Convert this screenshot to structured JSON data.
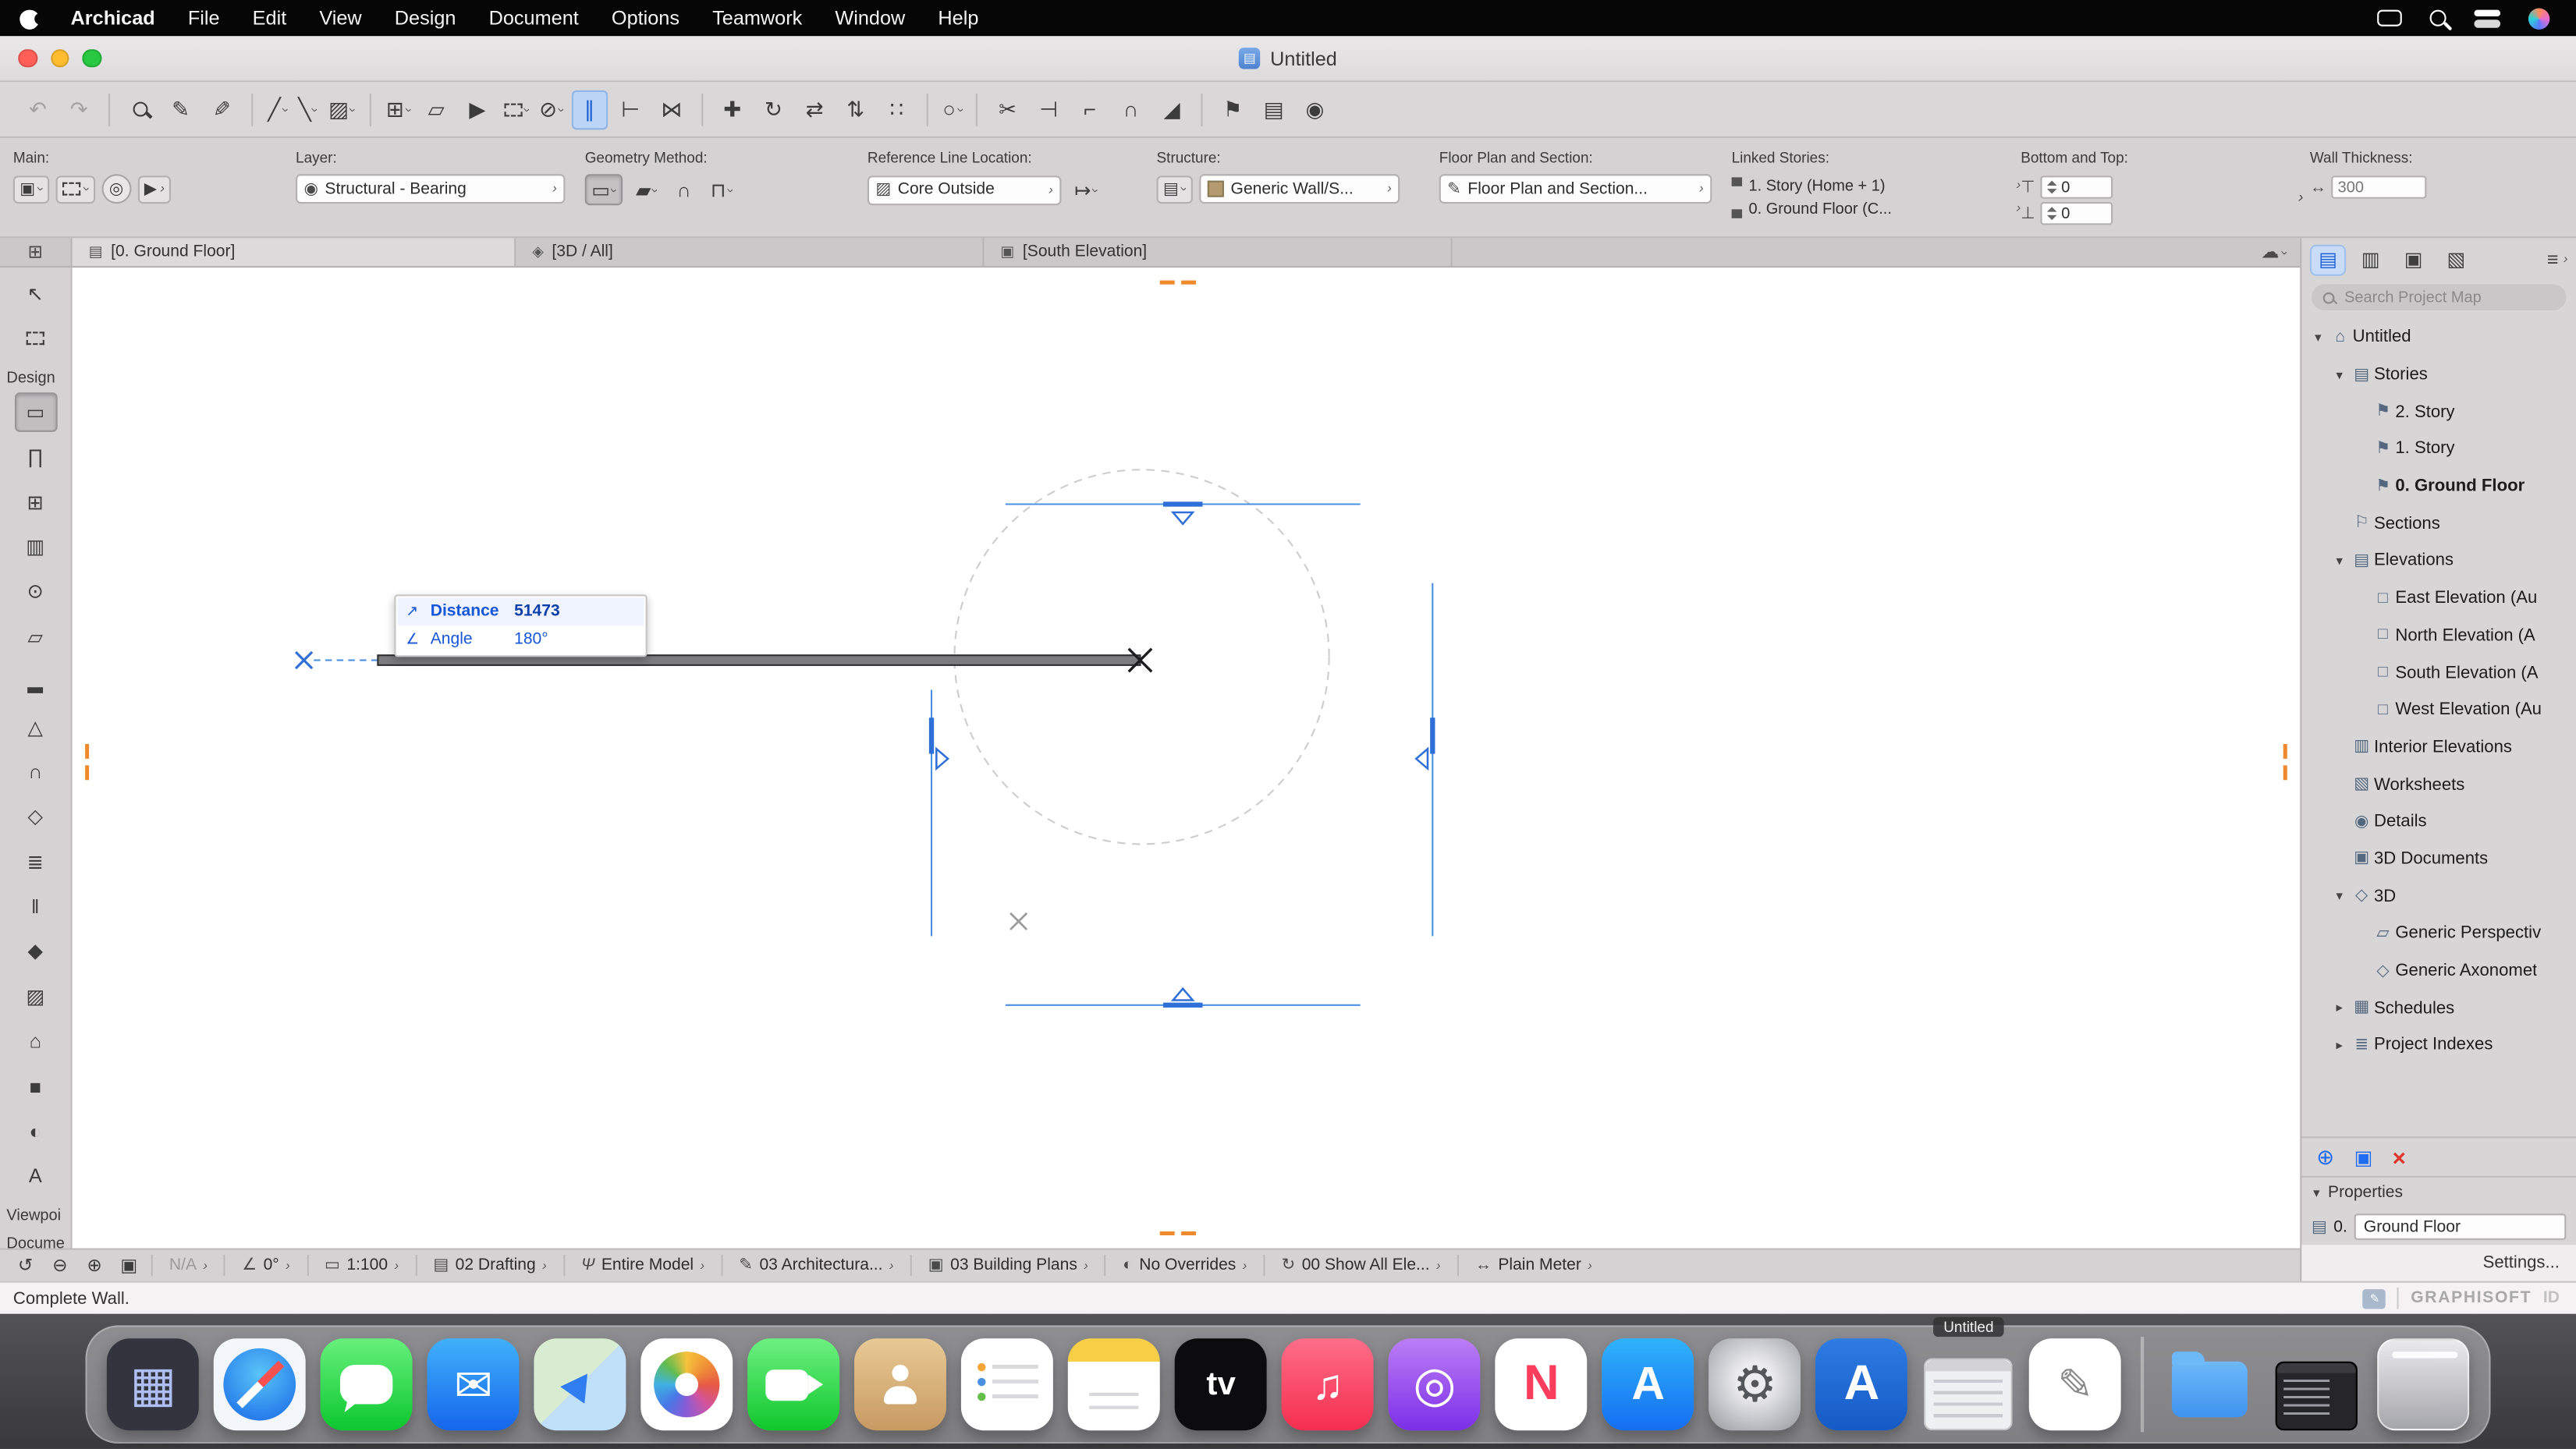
{
  "menu_bar": {
    "items": [
      "Archicad",
      "File",
      "Edit",
      "View",
      "Design",
      "Document",
      "Options",
      "Teamwork",
      "Window",
      "Help"
    ],
    "status_icons": [
      "display-icon",
      "spotlight-icon",
      "control-center-icon",
      "user-icon"
    ]
  },
  "window": {
    "title": "Untitled"
  },
  "toolbar": {
    "icons": [
      "undo-icon",
      "redo-icon",
      "zoom-icon",
      "pick-up-parameters-icon",
      "inject-parameters-icon",
      "pen-color-combo",
      "line-type-combo",
      "fill-type-combo",
      "grid-snap-combo",
      "editing-plane-icon",
      "snap-cursor-icon",
      "marquee-combo",
      "suspend-groups-combo",
      "guide-lines-toggle",
      "measure-icon",
      "virtual-trace-icon",
      "drag-icon",
      "rotate-icon",
      "mirror-icon",
      "elevate-icon",
      "multiply-icon",
      "arc-combo",
      "split-icon",
      "adjust-icon",
      "intersect-icon",
      "fillet-icon",
      "resize-icon",
      "marker-flag-icon",
      "layouts-icon",
      "camera-icon"
    ]
  },
  "info_box": {
    "main": {
      "label": "Main:"
    },
    "layer": {
      "label": "Layer:",
      "value": "Structural - Bearing"
    },
    "geometry": {
      "label": "Geometry Method:"
    },
    "reference_line": {
      "label": "Reference Line Location:",
      "value": "Core Outside"
    },
    "structure": {
      "label": "Structure:",
      "value": "Generic Wall/S..."
    },
    "floor_plan": {
      "label": "Floor Plan and Section:",
      "value": "Floor Plan and Section..."
    },
    "linked_stories": {
      "label": "Linked Stories:",
      "top": "1. Story (Home + 1)",
      "bottom": "0. Ground Floor (C..."
    },
    "bottom_top": {
      "label": "Bottom and Top:",
      "top_value": "0",
      "bottom_value": "0"
    },
    "wall_thickness": {
      "label": "Wall Thickness:",
      "value": "300"
    }
  },
  "tab_bar": {
    "tabs": [
      {
        "label": "[0. Ground Floor]"
      },
      {
        "label": "[3D / All]"
      },
      {
        "label": "[South Elevation]"
      }
    ]
  },
  "toolbox": {
    "design_label": "Design",
    "viewpoint_label": "Viewpoi",
    "document_label": "Docume",
    "tools": [
      "arrow-tool",
      "marquee-tool",
      "wall-tool",
      "door-tool",
      "window-tool",
      "curtain-wall-tool",
      "column-tool",
      "beam-tool",
      "slab-tool",
      "roof-tool",
      "shell-tool",
      "skylight-tool",
      "stair-tool",
      "railing-tool",
      "morph-tool",
      "mesh-tool",
      "zone-tool",
      "object-tool",
      "lamp-tool",
      "text-tool"
    ]
  },
  "canvas": {
    "tracker": {
      "distance_label": "Distance",
      "distance_value": "51473",
      "angle_label": "Angle",
      "angle_value": "180°"
    }
  },
  "navigator": {
    "search_placeholder": "Search Project Map",
    "tree": [
      {
        "label": "Untitled",
        "level": 0,
        "expanded": true
      },
      {
        "label": "Stories",
        "level": 1,
        "expanded": true
      },
      {
        "label": "2. Story",
        "level": 2
      },
      {
        "label": "1. Story",
        "level": 2
      },
      {
        "label": "0. Ground Floor",
        "level": 2,
        "selected": true
      },
      {
        "label": "Sections",
        "level": 1
      },
      {
        "label": "Elevations",
        "level": 1,
        "expanded": true
      },
      {
        "label": "East Elevation (Au",
        "level": 2
      },
      {
        "label": "North Elevation (A",
        "level": 2
      },
      {
        "label": "South Elevation (A",
        "level": 2
      },
      {
        "label": "West Elevation (Au",
        "level": 2
      },
      {
        "label": "Interior Elevations",
        "level": 1
      },
      {
        "label": "Worksheets",
        "level": 1
      },
      {
        "label": "Details",
        "level": 1
      },
      {
        "label": "3D Documents",
        "level": 1
      },
      {
        "label": "3D",
        "level": 1,
        "expanded": true
      },
      {
        "label": "Generic Perspectiv",
        "level": 2
      },
      {
        "label": "Generic Axonomet",
        "level": 2
      },
      {
        "label": "Schedules",
        "level": 1,
        "collapsed": true
      },
      {
        "label": "Project Indexes",
        "level": 1,
        "collapsed": true
      }
    ],
    "properties": {
      "header": "Properties",
      "story_number": "0.",
      "story_name": "Ground Floor",
      "settings_label": "Settings..."
    }
  },
  "quick_options": {
    "items": [
      {
        "label": "N/A",
        "disabled": true
      },
      {
        "label": "0°"
      },
      {
        "label": "1:100"
      },
      {
        "label": "02 Drafting"
      },
      {
        "label": "Entire Model"
      },
      {
        "label": "03 Architectura..."
      },
      {
        "label": "03 Building Plans"
      },
      {
        "label": "No Overrides"
      },
      {
        "label": "00 Show All Ele..."
      },
      {
        "label": "Plain Meter"
      }
    ]
  },
  "status_bar": {
    "message": "Complete Wall.",
    "brand": "GRAPHISOFT",
    "brand_id": "ID"
  },
  "dock": {
    "window_label": "Untitled",
    "apps": [
      "launchpad",
      "safari",
      "messages",
      "mail",
      "maps",
      "photos",
      "facetime",
      "contacts",
      "reminders",
      "notes",
      "tv",
      "music",
      "podcasts",
      "news",
      "app-store",
      "system-settings",
      "archicad",
      "archicad-window",
      "textedit",
      "folder",
      "terminal-window",
      "trash"
    ]
  },
  "colors": {
    "accent_blue": "#1f6bf2",
    "guide_blue": "#4a90e2",
    "marker_blue": "#2f6fd8",
    "orange_marker": "#ef8a2e",
    "wall_fill": "#7c7c7e",
    "chrome_gray": "#d4d2d3"
  }
}
